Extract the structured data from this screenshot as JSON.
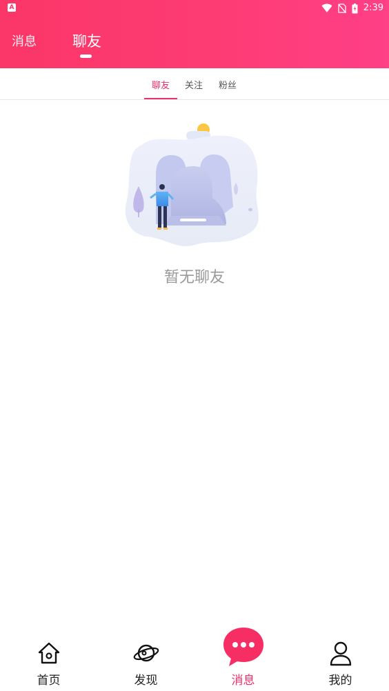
{
  "status_bar": {
    "time": "2:39",
    "app_badge": "A",
    "icons": [
      "wifi-icon",
      "no-sim-icon",
      "battery-icon"
    ]
  },
  "top_tabs": [
    {
      "label": "消息",
      "active": false
    },
    {
      "label": "聊友",
      "active": true
    }
  ],
  "sub_tabs": [
    {
      "label": "聊友",
      "active": true
    },
    {
      "label": "关注",
      "active": false
    },
    {
      "label": "粉丝",
      "active": false
    }
  ],
  "empty_state": {
    "message": "暂无聊友",
    "illustration": "empty-friends-illustration"
  },
  "bottom_nav": [
    {
      "label": "首页",
      "icon": "home-icon",
      "active": false
    },
    {
      "label": "发现",
      "icon": "planet-icon",
      "active": false
    },
    {
      "label": "消息",
      "icon": "chat-bubble-icon",
      "active": true
    },
    {
      "label": "我的",
      "icon": "user-icon",
      "active": false
    }
  ],
  "colors": {
    "header_gradient_start": "#fb3668",
    "header_gradient_end": "#ff3f86",
    "accent": "#e8306a",
    "empty_text": "#999999"
  }
}
